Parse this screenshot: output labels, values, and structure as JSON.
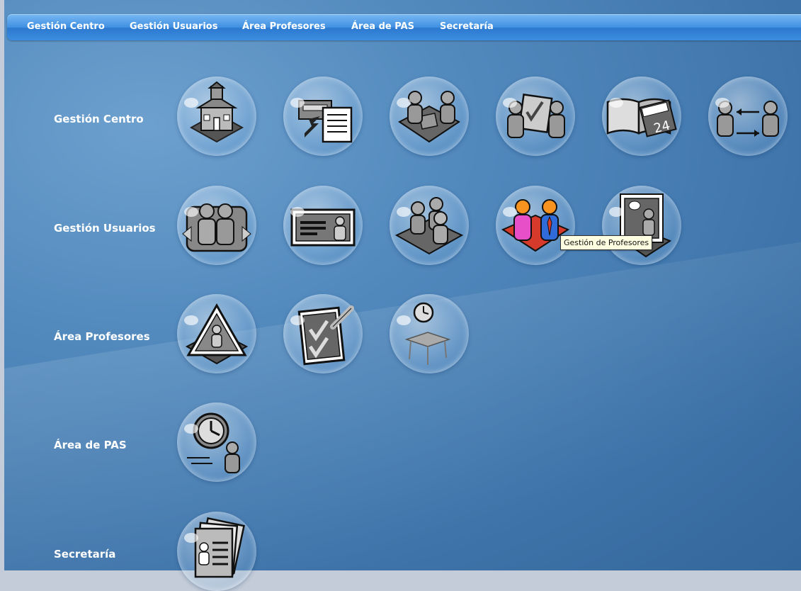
{
  "nav": {
    "items": [
      "Gestión Centro",
      "Gestión Usuarios",
      "Área Profesores",
      "Área de PAS",
      "Secretaría"
    ]
  },
  "rows": [
    {
      "label": "Gestión Centro",
      "icons": [
        "school-building-icon",
        "select-list-icon",
        "meeting-table-icon",
        "vote-checklist-icon",
        "calendar-book-icon",
        "users-exchange-icon"
      ]
    },
    {
      "label": "Gestión Usuarios",
      "icons": [
        "user-sync-icon",
        "id-card-icon",
        "user-group-icon",
        "profesores-icon",
        "blackboard-icon"
      ]
    },
    {
      "label": "Área Profesores",
      "icons": [
        "warning-person-icon",
        "checklist-icon",
        "schedule-desk-icon"
      ]
    },
    {
      "label": "Área de PAS",
      "icons": [
        "clock-person-icon"
      ]
    },
    {
      "label": "Secretaría",
      "icons": [
        "documents-icon"
      ]
    }
  ],
  "tooltip": {
    "text": "Gestión de Profesores"
  },
  "colors": {
    "navbar": "#3f8fe1",
    "background": "#4f86bc",
    "tooltip_bg": "#ffffe1",
    "highlight_red": "#d63a2a",
    "orange_head": "#f7931e"
  }
}
